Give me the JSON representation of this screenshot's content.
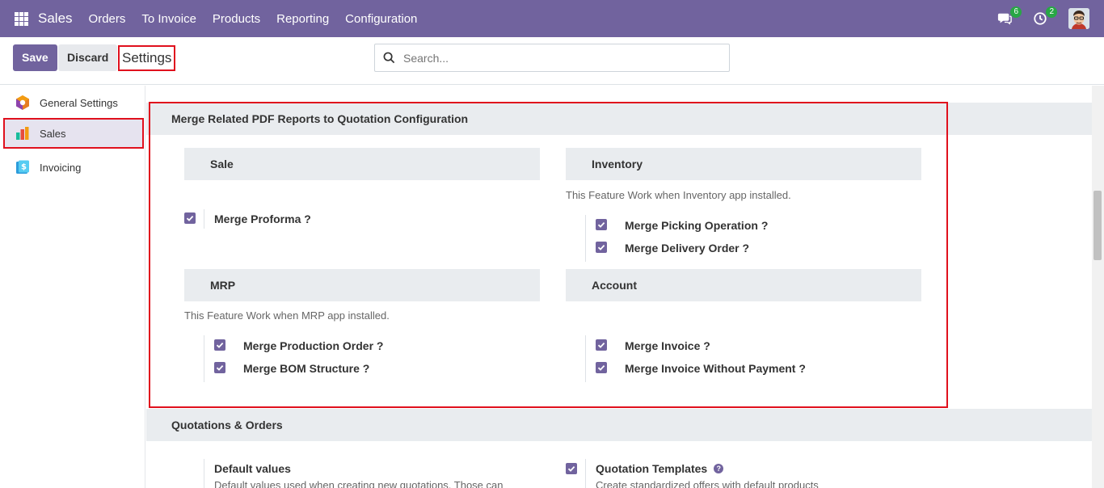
{
  "navbar": {
    "brand": "Sales",
    "menu": [
      "Orders",
      "To Invoice",
      "Products",
      "Reporting",
      "Configuration"
    ],
    "messages_count": "6",
    "activities_count": "2"
  },
  "control": {
    "save_label": "Save",
    "discard_label": "Discard",
    "title": "Settings",
    "search_placeholder": "Search..."
  },
  "sidebar": {
    "items": [
      {
        "label": "General Settings",
        "icon": "general-settings-icon"
      },
      {
        "label": "Sales",
        "icon": "sales-icon",
        "active": true
      },
      {
        "label": "Invoicing",
        "icon": "invoicing-icon"
      }
    ]
  },
  "merge_section": {
    "title": "Merge Related PDF Reports to Quotation Configuration",
    "sale": {
      "header": "Sale",
      "options": [
        {
          "label": "Merge Proforma ?",
          "checked": true
        }
      ]
    },
    "inventory": {
      "header": "Inventory",
      "hint": "This Feature Work when Inventory app installed.",
      "options": [
        {
          "label": "Merge Picking Operation ?",
          "checked": true
        },
        {
          "label": "Merge Delivery Order ?",
          "checked": true
        }
      ]
    },
    "mrp": {
      "header": "MRP",
      "hint": "This Feature Work when MRP app installed.",
      "options": [
        {
          "label": "Merge Production Order ?",
          "checked": true
        },
        {
          "label": "Merge BOM Structure ?",
          "checked": true
        }
      ]
    },
    "account": {
      "header": "Account",
      "options": [
        {
          "label": "Merge Invoice ?",
          "checked": true
        },
        {
          "label": "Merge Invoice Without Payment ?",
          "checked": true
        }
      ]
    }
  },
  "quotations_section": {
    "title": "Quotations & Orders",
    "default_values_label": "Default values",
    "default_values_desc": "Default values used when creating new quotations. Those can",
    "quotation_templates_label": "Quotation Templates",
    "quotation_templates_desc": "Create standardized offers with default products"
  },
  "colors": {
    "brand": "#71639e",
    "highlight": "#e0101d",
    "badge": "#28a745"
  }
}
